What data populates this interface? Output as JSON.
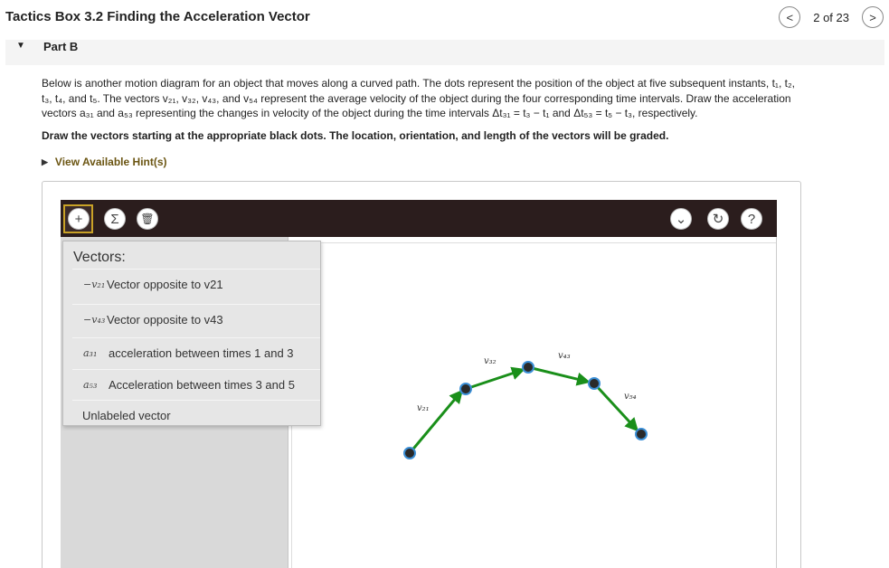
{
  "header": {
    "title": "Tactics Box 3.2 Finding the Acceleration Vector",
    "pager_text": "2 of 23",
    "prev_glyph": "<",
    "next_glyph": ">"
  },
  "part": {
    "label": "Part B",
    "caret": "▼"
  },
  "description": {
    "line1": "Below is another motion diagram for an object that moves along a curved path. The dots represent the position of the object at five subsequent instants, t₁, t₂,",
    "line2": "t₃, t₄, and t₅. The vectors v₂₁, v₃₂, v₄₃, and v₅₄ represent the average velocity of the object during the four corresponding time intervals. Draw the acceleration",
    "line3": "vectors a₃₁ and a₅₃ representing the changes in velocity of the object during the time intervals Δt₃₁ = t₃ − t₁ and Δt₅₃ = t₅ − t₃, respectively."
  },
  "instruction": "Draw the vectors starting at the appropriate black dots. The location, orientation, and length of the vectors will be graded.",
  "hint": {
    "label": "View Available Hint(s)",
    "caret": "▶"
  },
  "toolbar": {
    "add_glyph": "+",
    "sum_glyph": "Σ",
    "trash_glyph": "🗑",
    "dropdown_glyph": "⌄",
    "reset_glyph": "↻",
    "help_glyph": "?"
  },
  "vector_menu": {
    "title": "Vectors:",
    "items": [
      {
        "symbol": "−v₂₁",
        "label": "Vector opposite to v21"
      },
      {
        "symbol": "−v₄₃",
        "label": "Vector opposite to v43"
      },
      {
        "symbol": "a₃₁",
        "label": "acceleration between times 1 and 3"
      },
      {
        "symbol": "a₅₃",
        "label": "Acceleration between times 3 and 5"
      },
      {
        "symbol": "",
        "label": "Unlabeled vector"
      }
    ]
  },
  "diagram": {
    "labels": [
      "v₂₁",
      "v₃₂",
      "v₄₃",
      "v₅₄"
    ],
    "arrow_color": "#1a8f1a",
    "dot_color": "#2a2a2a",
    "ring_color": "#3b8fd6"
  }
}
